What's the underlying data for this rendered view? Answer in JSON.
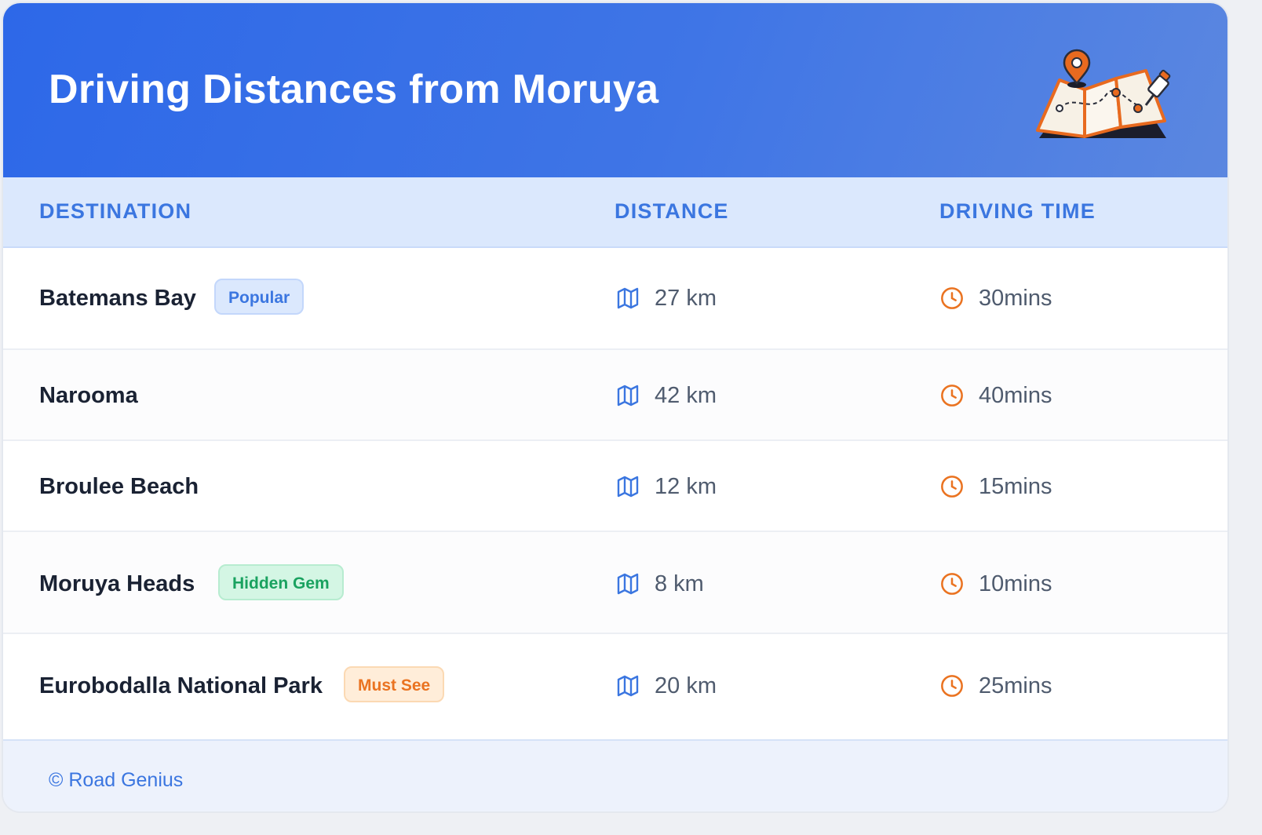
{
  "header": {
    "title": "Driving Distances from Moruya",
    "illustration": "map-with-pins-icon"
  },
  "columns": [
    "DESTINATION",
    "DISTANCE",
    "DRIVING TIME"
  ],
  "rows": [
    {
      "destination": "Batemans Bay",
      "badge": "Popular",
      "badge_color": "#3b76e0",
      "distance": "27 km",
      "time": "30mins"
    },
    {
      "destination": "Narooma",
      "badge": null,
      "distance": "42 km",
      "time": "40mins"
    },
    {
      "destination": "Broulee Beach",
      "badge": null,
      "distance": "12 km",
      "time": "15mins"
    },
    {
      "destination": "Moruya Heads",
      "badge": "Hidden Gem",
      "badge_color": "#1aa260",
      "distance": "8 km",
      "time": "10mins"
    },
    {
      "destination": "Eurobodalla National Park",
      "badge": "Must See",
      "badge_color": "#ea7321",
      "distance": "20 km",
      "time": "25mins"
    }
  ],
  "icons": {
    "distance": "map-icon",
    "time": "clock-icon"
  },
  "colors": {
    "header_start": "#2d68e8",
    "accent_blue": "#3b76e0",
    "accent_orange": "#ea7321"
  },
  "footer": {
    "text": "© Road Genius"
  }
}
